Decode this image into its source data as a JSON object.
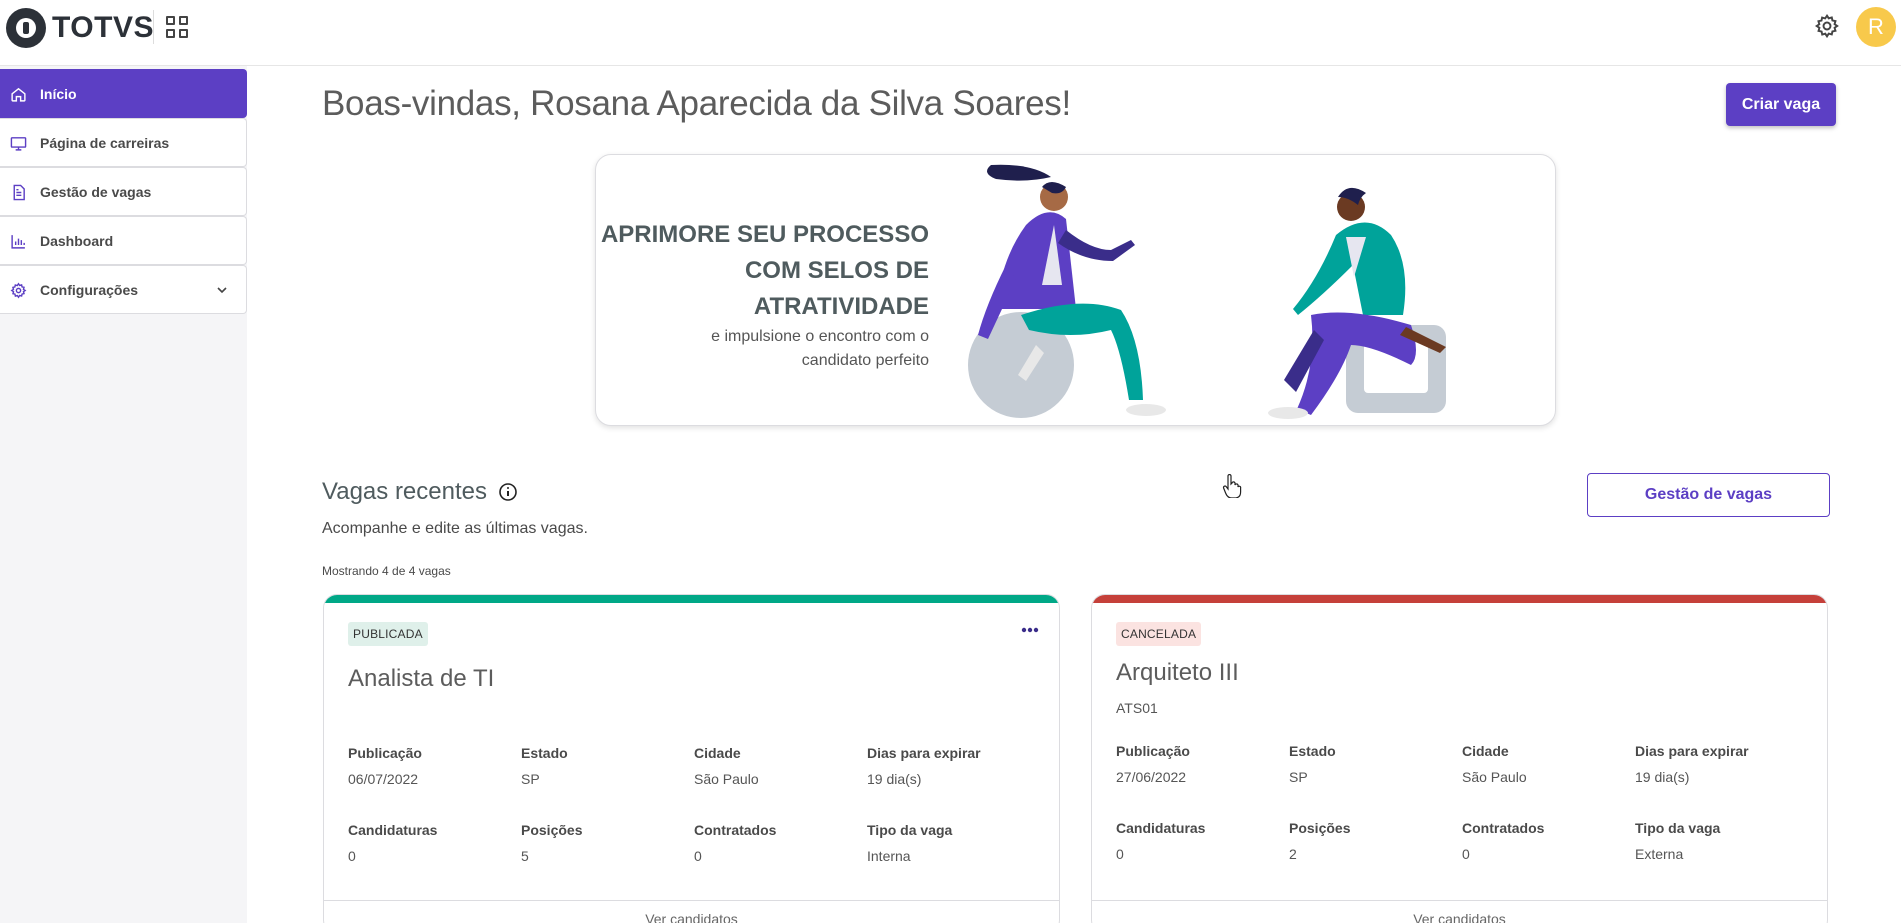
{
  "header": {
    "logo_text": "TOTVS",
    "avatar_letter": "R",
    "avatar_color": "#f8c94b"
  },
  "sidebar": {
    "items": [
      {
        "label": "Início",
        "icon": "home-icon",
        "active": true
      },
      {
        "label": "Página de carreiras",
        "icon": "monitor-icon"
      },
      {
        "label": "Gestão de vagas",
        "icon": "document-icon"
      },
      {
        "label": "Dashboard",
        "icon": "bar-chart-icon"
      },
      {
        "label": "Configurações",
        "icon": "gear-icon",
        "expandable": true
      }
    ]
  },
  "main": {
    "welcome": "Boas-vindas, Rosana Aparecida da Silva Soares!",
    "create_button": "Criar vaga",
    "banner": {
      "title_lines": [
        "APRIMORE SEU PROCESSO",
        "COM SELOS DE",
        "ATRATIVIDADE"
      ],
      "subtitle_lines": [
        "e impulsione o encontro com o",
        "candidato perfeito"
      ]
    },
    "recent": {
      "title": "Vagas recentes",
      "subtitle": "Acompanhe e edite as últimas vagas.",
      "manage_button": "Gestão de vagas",
      "showing": "Mostrando 4 de 4 vagas"
    },
    "cards": [
      {
        "status": "PUBLICADA",
        "status_color": "#00a887",
        "title": "Analista de TI",
        "code": "",
        "labels": [
          "Publicação",
          "Estado",
          "Cidade",
          "Dias para expirar",
          "Candidaturas",
          "Posições",
          "Contratados",
          "Tipo da vaga"
        ],
        "values": [
          "06/07/2022",
          "SP",
          "São Paulo",
          "19 dia(s)",
          "0",
          "5",
          "0",
          "Interna"
        ],
        "footer": "Ver candidatos"
      },
      {
        "status": "CANCELADA",
        "status_color": "#c5403a",
        "title": "Arquiteto III",
        "code": "ATS01",
        "labels": [
          "Publicação",
          "Estado",
          "Cidade",
          "Dias para expirar",
          "Candidaturas",
          "Posições",
          "Contratados",
          "Tipo da vaga"
        ],
        "values": [
          "27/06/2022",
          "SP",
          "São Paulo",
          "19 dia(s)",
          "0",
          "2",
          "0",
          "Externa"
        ],
        "footer": "Ver candidatos"
      }
    ]
  },
  "colors": {
    "primary": "#5c3fc4",
    "published": "#00a887",
    "cancelled": "#c5403a"
  }
}
